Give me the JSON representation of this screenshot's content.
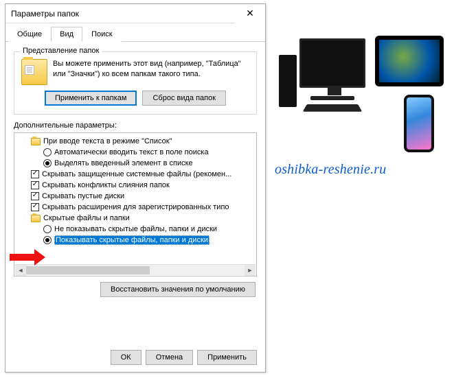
{
  "dialog": {
    "title": "Параметры папок",
    "close_glyph": "✕"
  },
  "tabs": {
    "items": [
      {
        "label": "Общие"
      },
      {
        "label": "Вид"
      },
      {
        "label": "Поиск"
      }
    ],
    "active_index": 1
  },
  "group": {
    "legend": "Представление папок",
    "text": "Вы можете применить этот вид (например, \"Таблица\" или \"Значки\") ко всем папкам такого типа.",
    "apply_label": "Применить к папкам",
    "reset_label": "Сброс вида папок"
  },
  "advanced_label": "Дополнительные параметры:",
  "tree": [
    {
      "type": "folder",
      "level": 1,
      "label": "При вводе текста в режиме \"Список\""
    },
    {
      "type": "radio",
      "level": 2,
      "checked": false,
      "label": "Автоматически вводить текст в поле поиска"
    },
    {
      "type": "radio",
      "level": 2,
      "checked": true,
      "label": "Выделять введенный элемент в списке"
    },
    {
      "type": "check",
      "level": 1,
      "checked": true,
      "label": "Скрывать защищенные системные файлы (рекомен..."
    },
    {
      "type": "check",
      "level": 1,
      "checked": true,
      "label": "Скрывать конфликты слияния папок"
    },
    {
      "type": "check",
      "level": 1,
      "checked": true,
      "label": "Скрывать пустые диски"
    },
    {
      "type": "check",
      "level": 1,
      "checked": true,
      "label": "Скрывать расширения для зарегистрированных типо"
    },
    {
      "type": "folder",
      "level": 1,
      "label": "Скрытые файлы и папки"
    },
    {
      "type": "radio",
      "level": 2,
      "checked": false,
      "label": "Не показывать скрытые файлы, папки и диски"
    },
    {
      "type": "radio",
      "level": 2,
      "checked": true,
      "selected": true,
      "label": "Показывать скрытые файлы, папки и диски"
    }
  ],
  "scroll": {
    "left_glyph": "◄",
    "right_glyph": "►"
  },
  "restore_label": "Восстановить значения по умолчанию",
  "footer": {
    "ok": "ОК",
    "cancel": "Отмена",
    "apply": "Применить"
  },
  "promo_text": "oshibka-reshenie.ru"
}
